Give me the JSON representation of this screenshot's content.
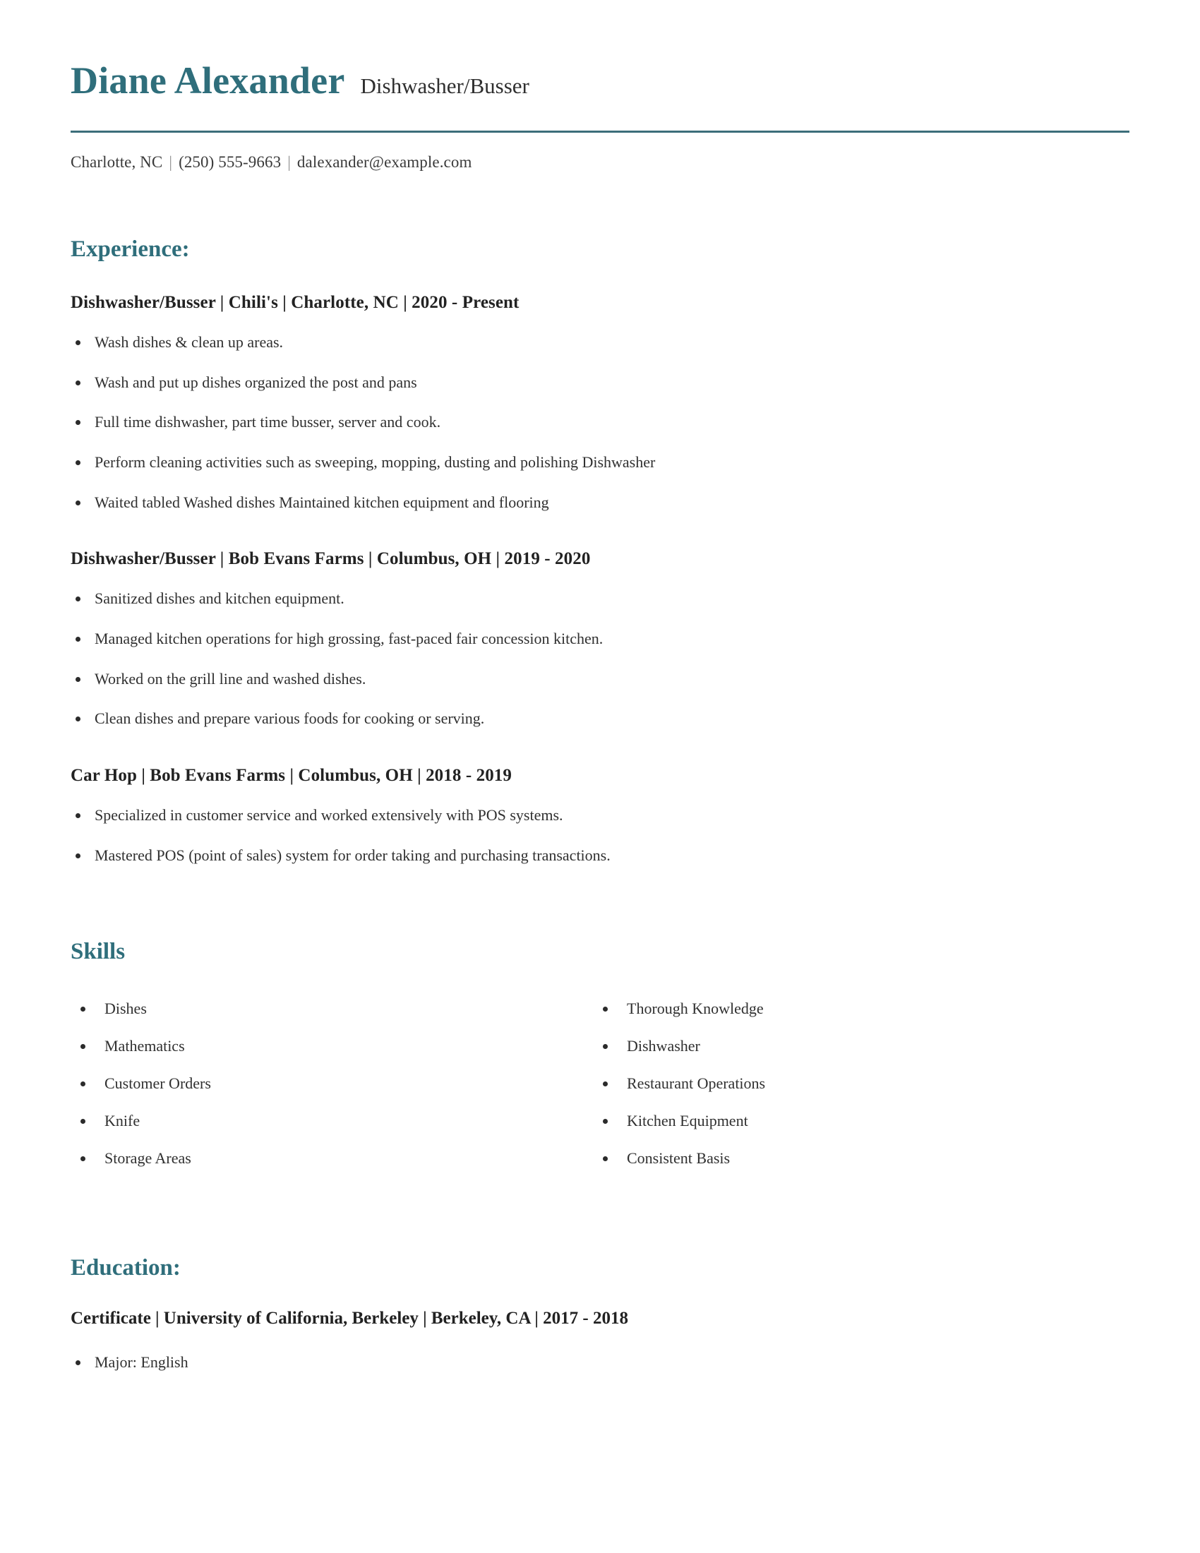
{
  "header": {
    "name": "Diane Alexander",
    "job_title": "Dishwasher/Busser",
    "accent_color": "#2f6e7b",
    "rule_color": "#3c6e7a",
    "contact": {
      "location": "Charlotte, NC",
      "phone": "(250) 555-9663",
      "email": "dalexander@example.com",
      "separator": "|"
    }
  },
  "experience": {
    "heading": "Experience:",
    "entries": [
      {
        "heading": "Dishwasher/Busser | Chili's | Charlotte, NC | 2020 - Present",
        "bullets": [
          "Wash dishes & clean up areas.",
          "Wash and put up dishes organized the post and pans",
          "Full time dishwasher, part time busser, server and cook.",
          "Perform cleaning activities such as sweeping, mopping, dusting and polishing Dishwasher",
          "Waited tabled Washed dishes Maintained kitchen equipment and flooring"
        ]
      },
      {
        "heading": "Dishwasher/Busser | Bob Evans Farms | Columbus, OH | 2019 - 2020",
        "bullets": [
          "Sanitized dishes and kitchen equipment.",
          "Managed kitchen operations for high grossing, fast-paced fair concession kitchen.",
          "Worked on the grill line and washed dishes.",
          "Clean dishes and prepare various foods for cooking or serving."
        ]
      },
      {
        "heading": "Car Hop | Bob Evans Farms | Columbus, OH | 2018 - 2019",
        "bullets": [
          "Specialized in customer service and worked extensively with POS systems.",
          "Mastered POS (point of sales) system for order taking and purchasing transactions."
        ]
      }
    ]
  },
  "skills": {
    "heading": "Skills",
    "columns": [
      [
        "Dishes",
        "Mathematics",
        "Customer Orders",
        "Knife",
        "Storage Areas"
      ],
      [
        "Thorough Knowledge",
        "Dishwasher",
        "Restaurant Operations",
        "Kitchen Equipment",
        "Consistent Basis"
      ]
    ]
  },
  "education": {
    "heading": "Education:",
    "entries": [
      {
        "heading": "Certificate | University of California, Berkeley | Berkeley, CA | 2017 - 2018",
        "bullets": [
          "Major: English"
        ]
      }
    ]
  }
}
